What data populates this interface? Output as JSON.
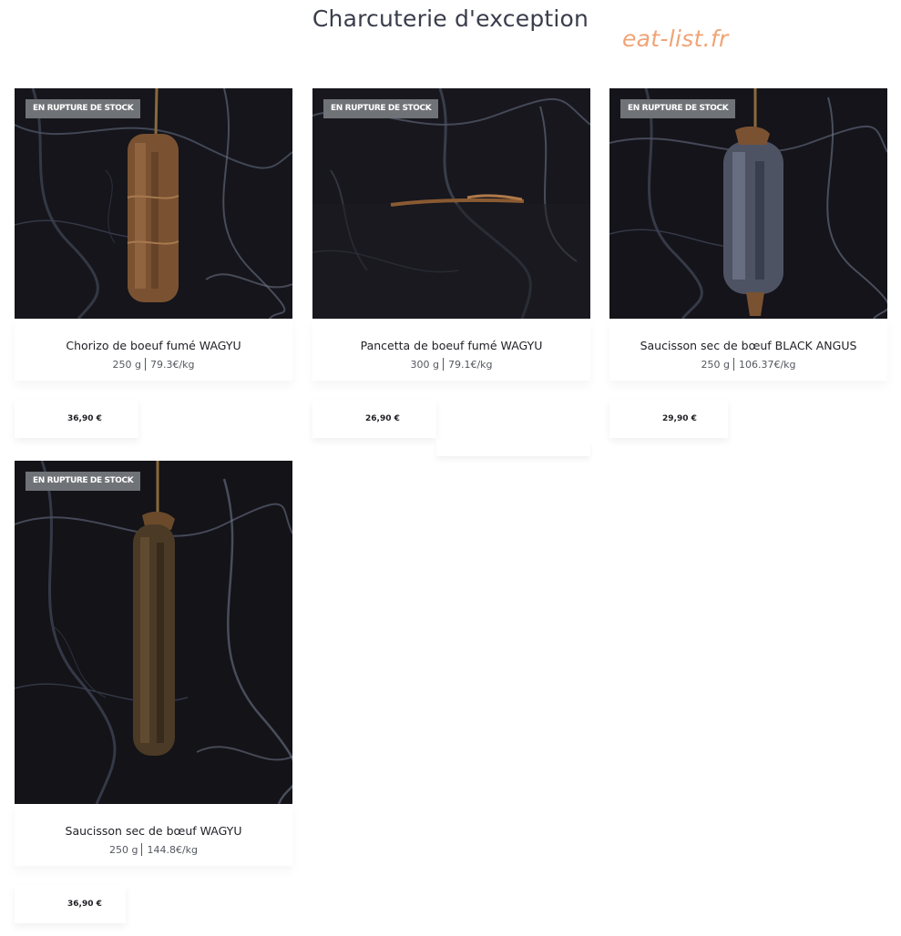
{
  "page": {
    "title": "Charcuterie d'exception",
    "watermark": "eat-list.fr"
  },
  "colors": {
    "badge_background": "#6f7276",
    "watermark": "#f0a477",
    "image_background": "#141419"
  },
  "products": [
    {
      "badge": "EN RUPTURE DE STOCK",
      "name": "Chorizo de boeuf fumé WAGYU",
      "weight": "250 g",
      "price_per_kg": "79.3€/kg",
      "price": "36,90 €",
      "image": "hanging-chorizo-on-black-marble"
    },
    {
      "badge": "EN RUPTURE DE STOCK",
      "name": "Pancetta de boeuf fumé WAGYU",
      "weight": "300 g",
      "price_per_kg": "79.1€/kg",
      "price": "26,90 €",
      "image": "pancetta-on-black-marble"
    },
    {
      "badge": "EN RUPTURE DE STOCK",
      "name": "Saucisson sec de bœuf BLACK ANGUS",
      "weight": "250 g",
      "price_per_kg": "106.37€/kg",
      "price": "29,90 €",
      "image": "hanging-saucisson-on-black-marble"
    },
    {
      "badge": "EN RUPTURE DE STOCK",
      "name": "Saucisson sec de bœuf WAGYU",
      "weight": "250 g",
      "price_per_kg": "144.8€/kg",
      "price": "36,90 €",
      "image": "hanging-saucisson-on-black-marble"
    }
  ]
}
